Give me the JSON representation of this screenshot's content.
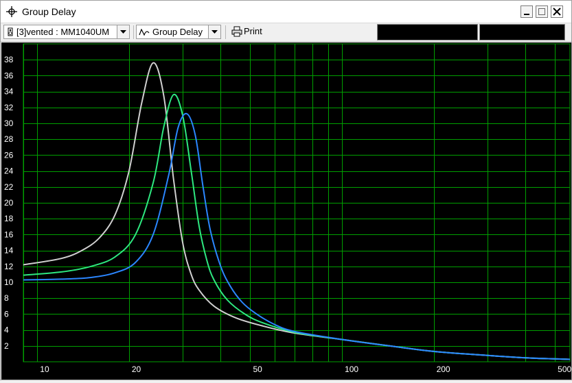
{
  "window": {
    "title": "Group Delay"
  },
  "toolbar": {
    "source_select_value": "[3]vented : MM1040UM",
    "view_select_value": "Group Delay",
    "print_label": "Print"
  },
  "icons": {
    "title": "crosshair-icon",
    "source": "speaker-icon",
    "view": "wave-icon",
    "print": "printer-icon",
    "minimize": "minimize-icon",
    "maximize": "maximize-icon",
    "close": "close-icon"
  },
  "colors": {
    "plot_background": "#000000",
    "grid": "#00a000",
    "series_white": "#d0d0d0",
    "series_green": "#2ee880",
    "series_blue": "#2b86ff"
  },
  "chart_data": {
    "type": "line",
    "title": "",
    "xlabel": "",
    "ylabel": "",
    "xscale": "log",
    "xlim": [
      9,
      560
    ],
    "ylim": [
      0,
      40
    ],
    "xtick_labels": [
      "10",
      "20",
      "50",
      "100",
      "200",
      "500"
    ],
    "ytick_labels": [
      "2",
      "4",
      "6",
      "8",
      "10",
      "12",
      "14",
      "16",
      "18",
      "20",
      "22",
      "24",
      "26",
      "28",
      "30",
      "32",
      "34",
      "36",
      "38"
    ],
    "grid": true,
    "series": [
      {
        "color": "#d0d0d0",
        "x": [
          9,
          12,
          14,
          16,
          18,
          20,
          22,
          24,
          26,
          28,
          30,
          32,
          34,
          38,
          45,
          55,
          70,
          100,
          150,
          200,
          300,
          400,
          560
        ],
        "y": [
          12.2,
          13.0,
          14.0,
          15.6,
          18.5,
          24.0,
          32.5,
          37.6,
          33.5,
          23.0,
          15.0,
          11.0,
          9.0,
          7.0,
          5.5,
          4.5,
          3.6,
          2.8,
          1.9,
          1.3,
          0.8,
          0.5,
          0.3
        ]
      },
      {
        "color": "#2ee880",
        "x": [
          9,
          12,
          15,
          18,
          21,
          24,
          26,
          28,
          30,
          32,
          34,
          36,
          38,
          42,
          48,
          55,
          70,
          100,
          150,
          200,
          300,
          400,
          560
        ],
        "y": [
          10.9,
          11.3,
          12.0,
          13.2,
          16.0,
          22.5,
          29.5,
          33.6,
          31.0,
          24.0,
          17.0,
          12.8,
          10.3,
          7.8,
          6.0,
          4.9,
          3.7,
          2.8,
          1.9,
          1.3,
          0.8,
          0.5,
          0.3
        ]
      },
      {
        "color": "#2b86ff",
        "x": [
          9,
          12,
          15,
          18,
          21,
          24,
          27,
          29,
          31,
          33,
          35,
          37,
          40,
          43,
          47,
          52,
          60,
          70,
          100,
          150,
          200,
          300,
          400,
          560
        ],
        "y": [
          10.3,
          10.4,
          10.6,
          11.2,
          12.5,
          16.0,
          23.5,
          29.5,
          31.2,
          28.5,
          22.0,
          16.5,
          12.0,
          9.5,
          7.5,
          6.1,
          4.7,
          3.8,
          2.8,
          1.9,
          1.3,
          0.8,
          0.5,
          0.3
        ]
      }
    ]
  }
}
